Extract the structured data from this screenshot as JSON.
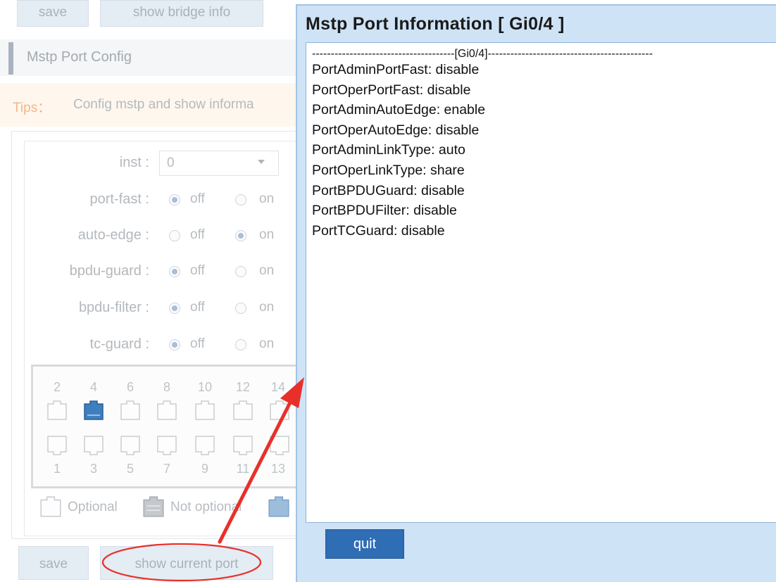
{
  "background": {
    "top_buttons": {
      "save": "save",
      "show_bridge_info": "show bridge info"
    },
    "section_title": "Mstp Port Config",
    "tips": {
      "label": "Tips：",
      "text": "Config mstp and show informa"
    },
    "form": {
      "inst": {
        "label": "inst :",
        "value": "0"
      },
      "rows": [
        {
          "label": "port-fast :",
          "off": "off",
          "on": "on",
          "selected": "off"
        },
        {
          "label": "auto-edge :",
          "off": "off",
          "on": "on",
          "selected": "on"
        },
        {
          "label": "bpdu-guard :",
          "off": "off",
          "on": "on",
          "selected": "off"
        },
        {
          "label": "bpdu-filter :",
          "off": "off",
          "on": "on",
          "selected": "off"
        },
        {
          "label": "tc-guard :",
          "off": "off",
          "on": "on",
          "selected": "off"
        }
      ]
    },
    "ports": {
      "top_numbers": [
        "2",
        "4",
        "6",
        "8",
        "10",
        "12",
        "14"
      ],
      "bottom_numbers": [
        "1",
        "3",
        "5",
        "7",
        "9",
        "11",
        "13"
      ],
      "selected_port": "4"
    },
    "legend": {
      "optional": "Optional",
      "not_optional": "Not optional"
    },
    "bottom_buttons": {
      "save": "save",
      "show_current_port": "show current port"
    }
  },
  "dialog": {
    "title": "Mstp Port Information [ Gi0/4 ]",
    "header_line": "--------------------------------------[Gi0/4]--------------------------------------------",
    "lines": [
      "PortAdminPortFast: disable",
      "PortOperPortFast: disable",
      "PortAdminAutoEdge: enable",
      "PortOperAutoEdge: disable",
      "PortAdminLinkType: auto",
      "PortOperLinkType: share",
      "PortBPDUGuard: disable",
      "PortBPDUFilter: disable",
      "PortTCGuard: disable"
    ],
    "quit_label": "quit"
  },
  "colors": {
    "dialog_bg": "#cfe3f6",
    "quit_button": "#2f6db5",
    "annotation_red": "#e8302a",
    "selected_port": "#3e7fbf"
  }
}
